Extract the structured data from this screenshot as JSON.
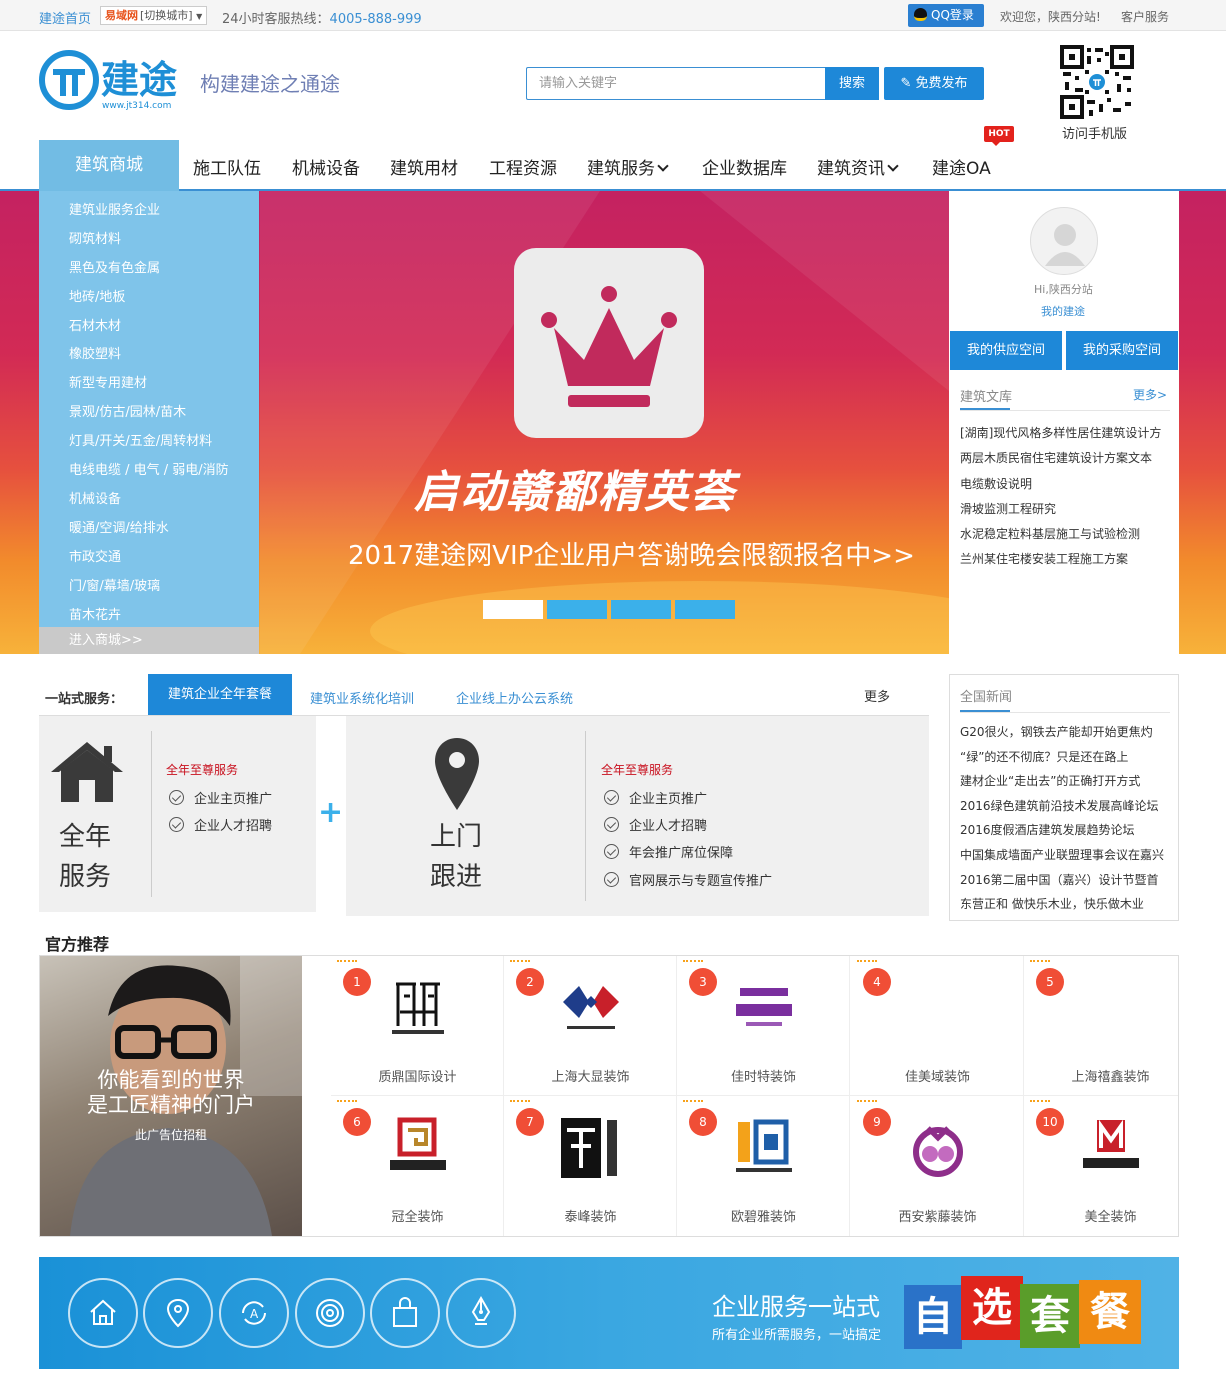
{
  "topbar": {
    "home": "建途首页",
    "city_site": "易域网",
    "city_switch": "[切换城市]",
    "hotline_label": "24小时客服热线：",
    "hotline": "4005-888-999",
    "qq_login": "QQ登录",
    "welcome": "欢迎您，陕西分站!",
    "customer_service": "客户服务"
  },
  "header": {
    "logo_text": "建途",
    "logo_url": "www.jt314.com",
    "slogan": "构建建途之通途",
    "search_placeholder": "请输入关键字",
    "search_button": "搜索",
    "publish_button": "免费发布",
    "qr_label": "访问手机版"
  },
  "nav": {
    "category": "建筑商城",
    "items": [
      "施工队伍",
      "机械设备",
      "建筑用材",
      "工程资源",
      "建筑服务",
      "企业数据库",
      "建筑资讯",
      "建途OA"
    ],
    "hot_badge": "HOT"
  },
  "sidebar": {
    "items": [
      "建筑业服务企业",
      "砌筑材料",
      "黑色及有色金属",
      "地砖/地板",
      "石材木材",
      "橡胶塑料",
      "新型专用建材",
      "景观/仿古/园林/苗木",
      "灯具/开关/五金/周转材料",
      "电线电缆 / 电气 / 弱电/消防",
      "机械设备",
      "暖通/空调/给排水",
      "市政交通",
      "门/窗/幕墙/玻璃",
      "苗木花卉"
    ],
    "more": "进入商城>>"
  },
  "banner": {
    "title": "启动赣鄱精英荟",
    "subtitle": "2017建途网VIP企业用户答谢晚会限额报名中>>",
    "active_slide": 1
  },
  "user_panel": {
    "greeting": "Hi,陕西分站",
    "my_link": "我的建途",
    "supply_space": "我的供应空间",
    "purchase_space": "我的采购空间",
    "library_title": "建筑文库",
    "library_more": "更多>",
    "library_items": [
      "[湖南]现代风格多样性居住建筑设计方",
      "两层木质民宿住宅建筑设计方案文本",
      "电缆敷设说明",
      "滑坡监测工程研究",
      "水泥稳定粒料基层施工与试验检测",
      "兰州某住宅楼安装工程施工方案"
    ]
  },
  "one_stop": {
    "label": "一站式服务：",
    "tabs": [
      "建筑企业全年套餐",
      "建筑业系统化培训",
      "企业线上办公云系统"
    ],
    "more": "更多",
    "panel1": {
      "title_line1": "全年",
      "title_line2": "服务",
      "heading": "全年至尊服务",
      "items": [
        "企业主页推广",
        "企业人才招聘"
      ]
    },
    "plus": "+",
    "panel2": {
      "title_line1": "上门",
      "title_line2": "跟进",
      "heading": "全年至尊服务",
      "items": [
        "企业主页推广",
        "企业人才招聘",
        "年会推广席位保障",
        "官网展示与专题宣传推广"
      ]
    }
  },
  "news": {
    "title": "全国新闻",
    "items": [
      "G20很火，钢铁去产能却开始更焦灼",
      "“绿”的还不彻底？只是还在路上",
      "建材企业“走出去”的正确打开方式",
      "2016绿色建筑前沿技术发展高峰论坛",
      "2016度假酒店建筑发展趋势论坛",
      "中国集成墙面产业联盟理事会议在嘉兴",
      "2016第二届中国（嘉兴）设计节暨首",
      "东营正和 做快乐木业，快乐做木业"
    ]
  },
  "official": {
    "title": "官方推荐",
    "ad_line1": "你能看到的世界",
    "ad_line2": "是工匠精神的门户",
    "ad_line3": "此广告位招租",
    "companies": [
      {
        "rank": "1",
        "name": "质鼎国际设计"
      },
      {
        "rank": "2",
        "name": "上海大显装饰"
      },
      {
        "rank": "3",
        "name": "佳时特装饰"
      },
      {
        "rank": "4",
        "name": "佳美域装饰"
      },
      {
        "rank": "5",
        "name": "上海禧鑫装饰"
      },
      {
        "rank": "6",
        "name": "冠全装饰"
      },
      {
        "rank": "7",
        "name": "泰峰装饰"
      },
      {
        "rank": "8",
        "name": "欧碧雅装饰"
      },
      {
        "rank": "9",
        "name": "西安紫藤装饰"
      },
      {
        "rank": "10",
        "name": "美全装饰"
      }
    ]
  },
  "bottom_banner": {
    "title": "企业服务一站式",
    "subtitle": "所有企业所需服务，一站搞定",
    "blocks": [
      "自",
      "选",
      "套",
      "餐"
    ],
    "block_colors": [
      "#2a72c8",
      "#e0251c",
      "#5a9d2a",
      "#f08a12"
    ]
  }
}
